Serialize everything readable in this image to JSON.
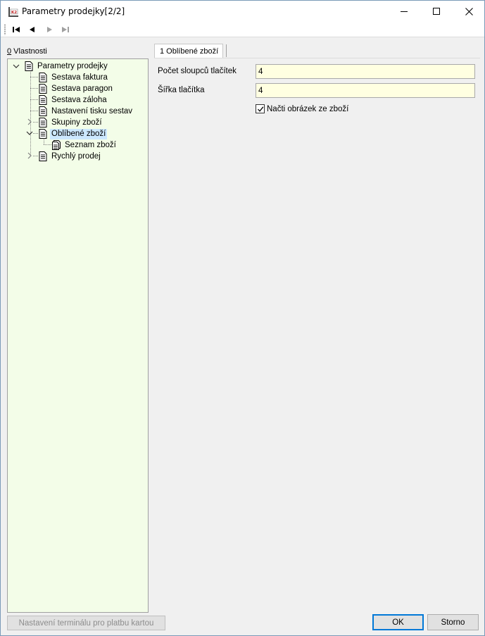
{
  "window": {
    "title": "Parametry prodejky[2/2]",
    "controls": {
      "minimize": "minimize-icon",
      "maximize": "maximize-icon",
      "close": "close-icon"
    }
  },
  "navigation": {
    "icons": [
      "first-record-icon",
      "previous-record-icon",
      "next-record-icon",
      "last-record-icon"
    ]
  },
  "left_panel": {
    "label_hotkey": "0",
    "label_text": " Vlastnosti",
    "tree": [
      {
        "label": "Parametry prodejky",
        "level": 0,
        "expander": "expanded"
      },
      {
        "label": "Sestava faktura",
        "level": 1,
        "expander": "none"
      },
      {
        "label": "Sestava paragon",
        "level": 1,
        "expander": "none"
      },
      {
        "label": "Sestava záloha",
        "level": 1,
        "expander": "none"
      },
      {
        "label": "Nastavení tisku sestav",
        "level": 1,
        "expander": "none"
      },
      {
        "label": "Skupiny zboží",
        "level": 1,
        "expander": "collapsed"
      },
      {
        "label": "Oblíbené zboží",
        "level": 1,
        "expander": "expanded",
        "selected": true
      },
      {
        "label": "Seznam zboží",
        "level": 2,
        "expander": "none"
      },
      {
        "label": "Rychlý prodej",
        "level": 1,
        "expander": "collapsed"
      }
    ],
    "terminal_button": "Nastavení terminálu pro platbu kartou"
  },
  "right_panel": {
    "tab_label": "1 Oblíbené zboží",
    "fields": [
      {
        "label": "Počet sloupců tlačítek",
        "value": "4"
      },
      {
        "label": "Šířka tlačítka",
        "value": "4"
      }
    ],
    "checkbox": {
      "label": "Načti obrázek ze zboží",
      "checked": true
    }
  },
  "footer": {
    "ok_label": "OK",
    "cancel_label": "Storno"
  },
  "colors": {
    "tree_background": "#f3fde8",
    "input_background": "#ffffe1",
    "selection": "#cce8ff",
    "focus_border": "#0078d7"
  }
}
